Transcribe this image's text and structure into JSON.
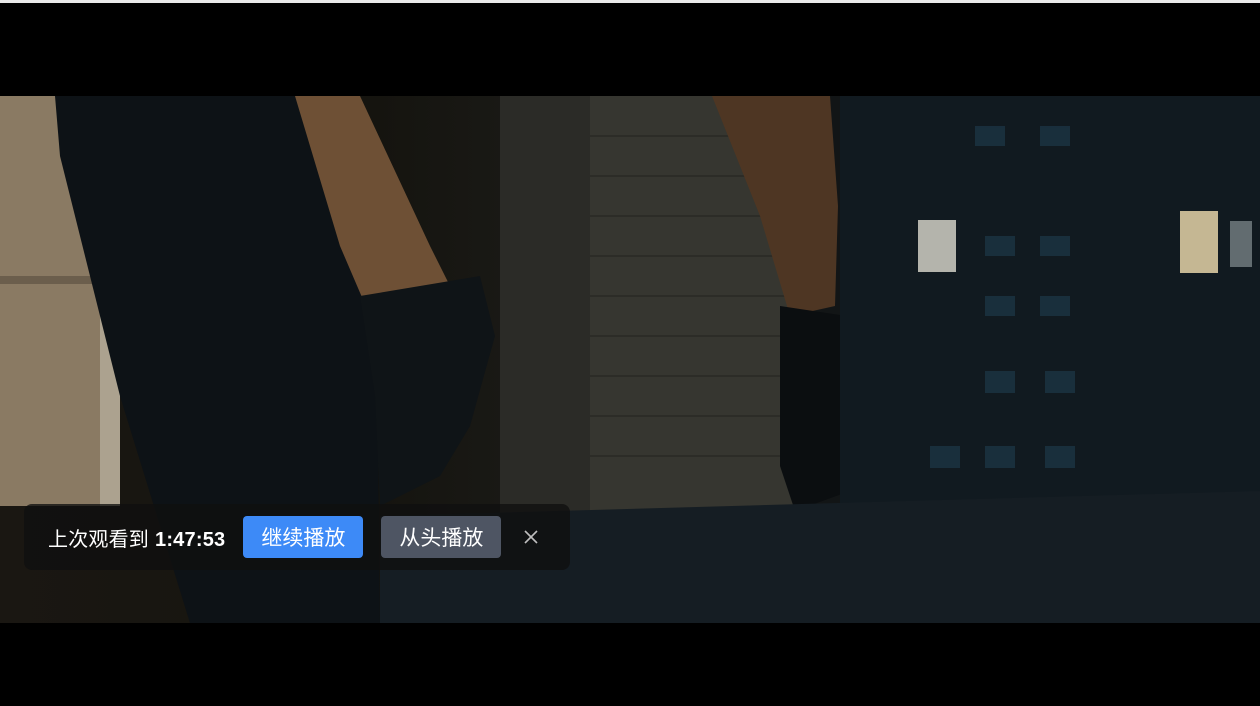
{
  "resume_prompt": {
    "label": "上次观看到",
    "timestamp": "1:47:53",
    "continue_label": "继续播放",
    "restart_label": "从头播放",
    "close_icon": "close-icon"
  },
  "colors": {
    "continue_button": "#3d8af7",
    "restart_button": "#4e5563",
    "bar_background": "rgba(15,15,15,0.78)"
  }
}
